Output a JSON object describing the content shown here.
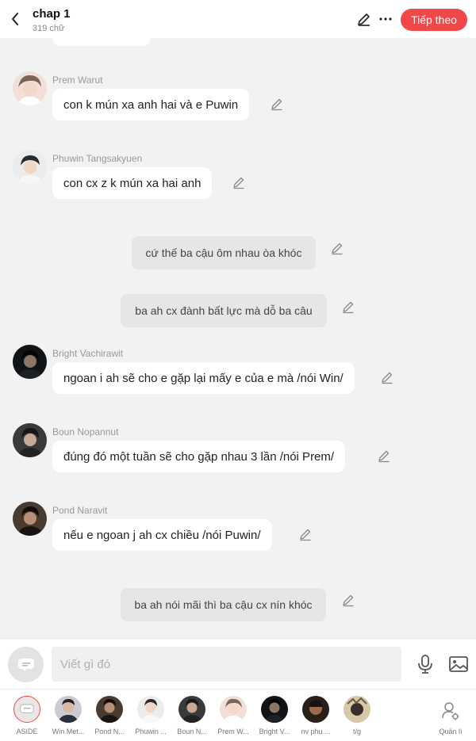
{
  "header": {
    "title": "chap 1",
    "word_count": "319 chữ",
    "next_label": "Tiếp theo",
    "accent_color": "#f04848"
  },
  "messages": [
    {
      "type": "dialogue",
      "sender": "Prem Warut",
      "text": "con k mún xa anh hai và e Puwin"
    },
    {
      "type": "dialogue",
      "sender": "Phuwin Tangsakyuen",
      "text": "con cx z k mún xa hai anh"
    },
    {
      "type": "narration",
      "text": "cứ thế ba cậu ôm nhau òa khóc"
    },
    {
      "type": "narration",
      "text": "ba ah cx đành bất lực mà dỗ ba câu"
    },
    {
      "type": "dialogue",
      "sender": "Bright Vachirawit",
      "text": "ngoan i ah sẽ cho e gặp lại mấy e của e mà /nói Win/"
    },
    {
      "type": "dialogue",
      "sender": "Boun Nopannut",
      "text": "đúng đó một tuần sẽ cho gặp nhau 3 lần /nói Prem/"
    },
    {
      "type": "dialogue",
      "sender": "Pond Naravit",
      "text": "nếu e ngoan j ah cx chiều /nói Puwin/"
    },
    {
      "type": "narration",
      "text": "ba ah nói mãi thì ba cậu cx nín khóc"
    }
  ],
  "input": {
    "placeholder": "Viết gì đó"
  },
  "characters": [
    {
      "label": "ASIDE"
    },
    {
      "label": "Win Met..."
    },
    {
      "label": "Pond N..."
    },
    {
      "label": "Phuwin ..."
    },
    {
      "label": "Boun N..."
    },
    {
      "label": "Prem W..."
    },
    {
      "label": "Bright V..."
    },
    {
      "label": "nv phụ ..."
    },
    {
      "label": "t/g"
    }
  ],
  "manage_label": "Quản lí"
}
